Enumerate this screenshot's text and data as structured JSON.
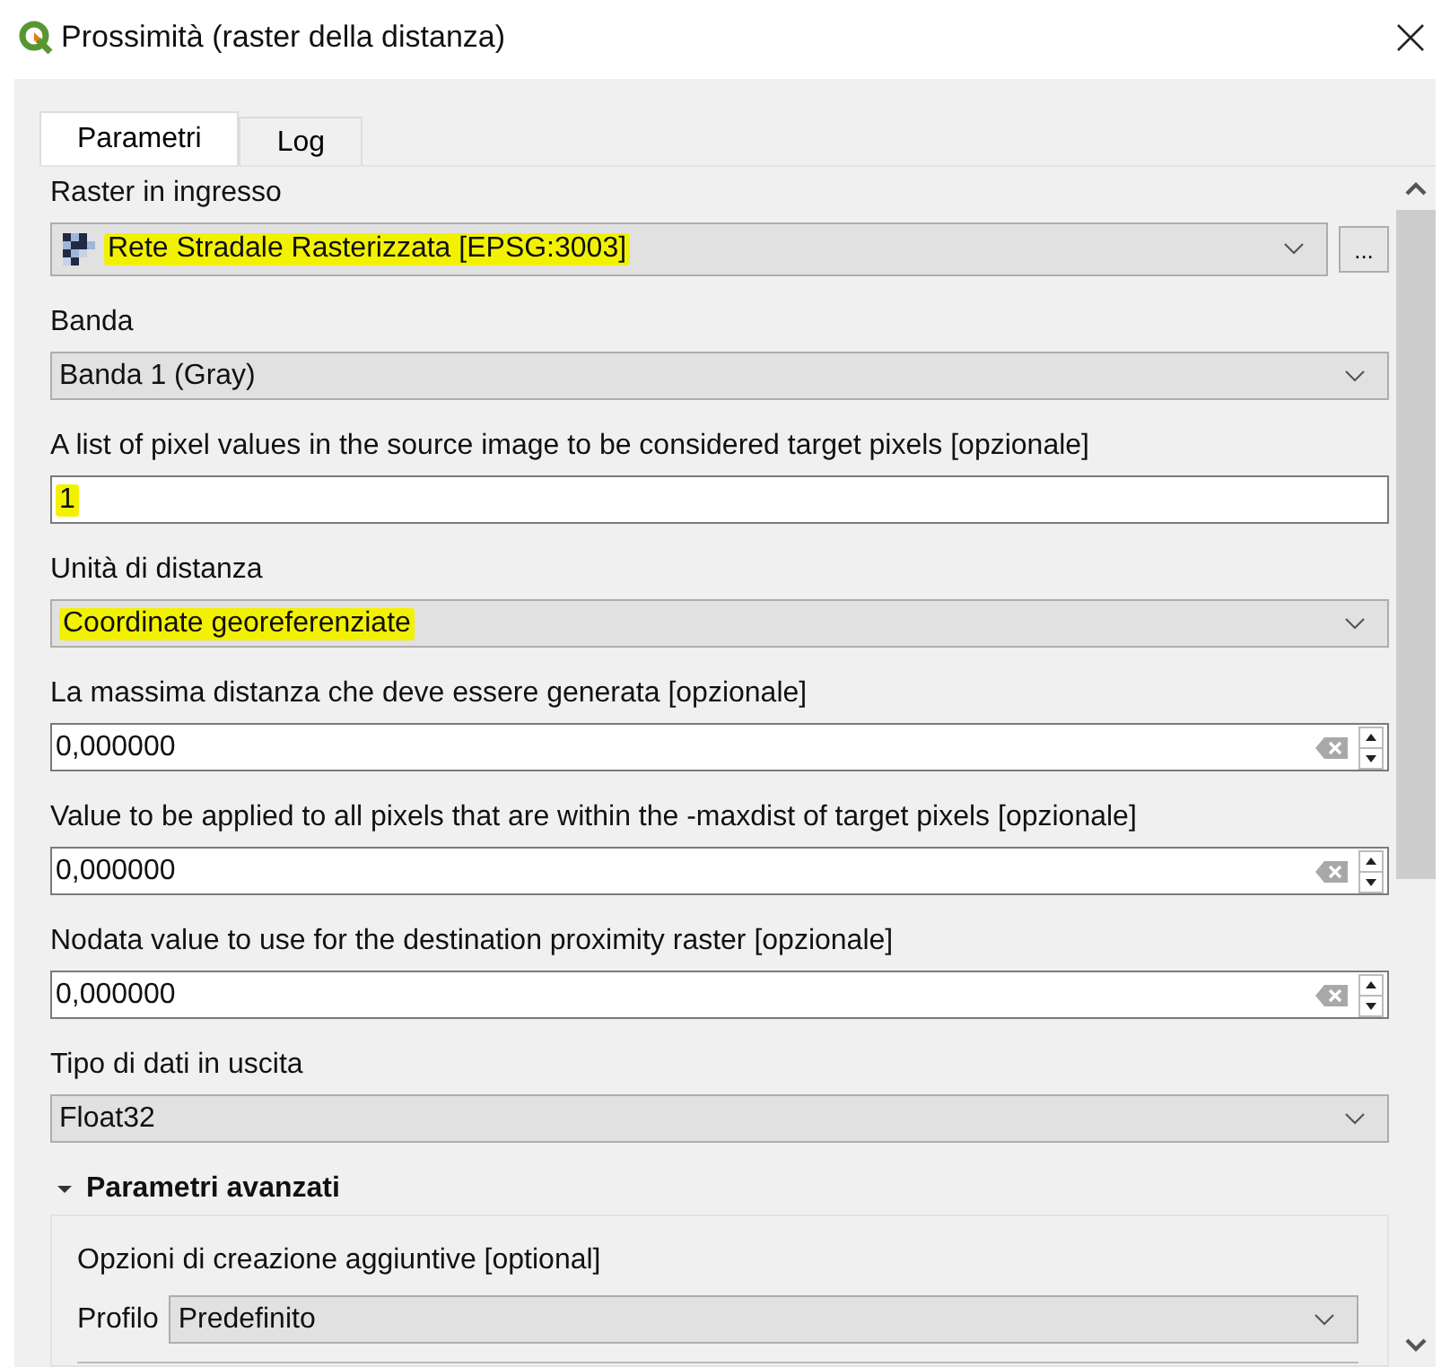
{
  "window": {
    "title": "Prossimità (raster della distanza)"
  },
  "tabs": [
    {
      "label": "Parametri",
      "selected": true
    },
    {
      "label": "Log",
      "selected": false
    }
  ],
  "parameters": [
    {
      "kind": "layer",
      "label": "Raster in ingresso",
      "value": "Rete Stradale Rasterizzata [EPSG:3003]",
      "highlighted": true,
      "browse": "..."
    },
    {
      "kind": "combo",
      "label": "Banda",
      "value": "Banda 1 (Gray)",
      "highlighted": false
    },
    {
      "kind": "text",
      "label": "A list of pixel values in the source image to be considered target pixels [opzionale]",
      "value": "1",
      "highlighted": true
    },
    {
      "kind": "combo",
      "label": "Unità di distanza",
      "value": "Coordinate georeferenziate",
      "highlighted": true
    },
    {
      "kind": "spin",
      "label": "La massima distanza che deve essere generata [opzionale]",
      "value": "0,000000",
      "highlighted": false
    },
    {
      "kind": "spin",
      "label": "Value to be applied to all pixels that are within the -maxdist of target pixels [opzionale]",
      "value": "0,000000",
      "highlighted": false
    },
    {
      "kind": "spin",
      "label": "Nodata value to use for the destination proximity raster [opzionale]",
      "value": "0,000000",
      "highlighted": false
    },
    {
      "kind": "combo",
      "label": "Tipo di dati in uscita",
      "value": "Float32",
      "highlighted": false
    }
  ],
  "advanced": {
    "title": "Parametri avanzati",
    "expanded": true,
    "label": "Opzioni di creazione aggiuntive [optional]",
    "profile_label": "Profilo",
    "profile_value": "Predefinito"
  }
}
